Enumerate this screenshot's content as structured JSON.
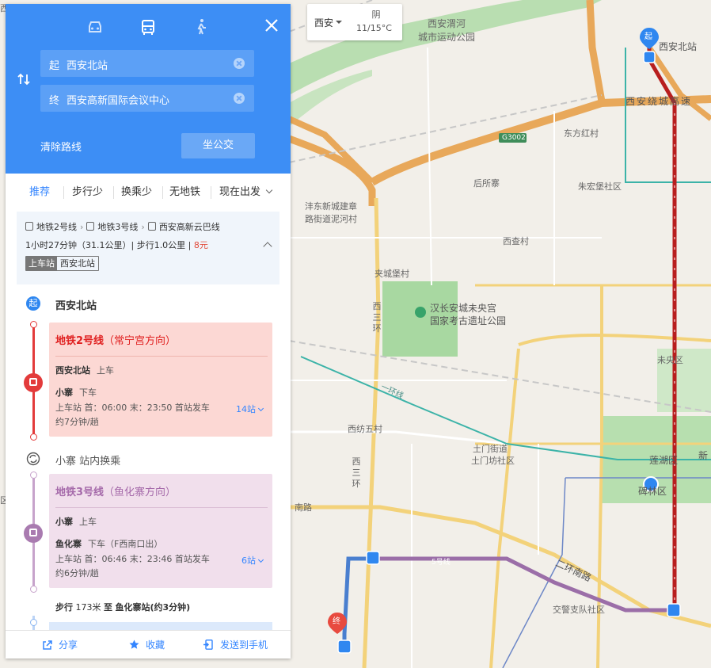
{
  "weather": {
    "city": "西安",
    "condition": "阴",
    "temp": "11/15°C"
  },
  "header": {
    "modes": [
      {
        "name": "drive",
        "icon": "car-icon"
      },
      {
        "name": "bus",
        "icon": "bus-icon",
        "active": true
      },
      {
        "name": "walk",
        "icon": "walk-icon"
      }
    ],
    "start_tag": "起",
    "start_value": "西安北站",
    "end_tag": "终",
    "end_value": "西安高新国际会议中心",
    "clear_label": "清除路线",
    "bus_button": "坐公交"
  },
  "prefs": {
    "items": [
      "推荐",
      "步行少",
      "换乘少",
      "无地铁"
    ],
    "depart_label": "现在出发"
  },
  "plan": {
    "lines": [
      "地铁2号线",
      "地铁3号线",
      "西安高新云巴线"
    ],
    "stats_prefix": "1小时27分钟（31.1公里）| 步行1.0公里 | ",
    "price": "8元",
    "board_key": "上车站",
    "board_value": "西安北站"
  },
  "route": {
    "start_circle": "起",
    "start_station": "西安北站",
    "segments": [
      {
        "line": "地铁2号线",
        "direction": "（常宁宫方向）",
        "board_station": "西安北站",
        "board_label": "上车",
        "alight_station": "小寨",
        "alight_label": "下车",
        "schedule": "上车站 首：06:00  末：23:50  首站发车",
        "interval": "约7分钟/趟",
        "stops": "14站"
      },
      {
        "line": "地铁3号线",
        "direction": "（鱼化寨方向）",
        "board_station": "小寨",
        "board_label": "上车",
        "alight_station": "鱼化寨",
        "alight_label": "下车（F西南口出）",
        "schedule": "上车站 首：06:46  末：23:46  首站发车",
        "interval": "约6分钟/趟",
        "stops": "6站"
      }
    ],
    "transfer_station": "小寨",
    "transfer_label": "站内换乘",
    "walk_prefix": "步行",
    "walk_distance": "173米",
    "walk_to": "至",
    "walk_target": "鱼化寨站(约3分钟)"
  },
  "bottom": {
    "share": "分享",
    "favorite": "收藏",
    "send": "发送到手机"
  },
  "map": {
    "labels": [
      "西安渭河",
      "城市运动公园",
      "西安北站",
      "西安绕城高速",
      "G3002",
      "东方红村",
      "后所寨",
      "朱宏堡社区",
      "沣东新城建章",
      "路街道泥河村",
      "西查村",
      "夹城堡村",
      "汉长安城未央宫",
      "国家考古遗址公园",
      "未央区",
      "一环线",
      "西纺五村",
      "土门街道",
      "土门坊社区",
      "莲湖区",
      "碑林区",
      "南路",
      "二环南路",
      "交警支队社区",
      "5号线",
      "新",
      "西三环",
      "西三环",
      "起",
      "终",
      "西",
      "区"
    ]
  },
  "colors": {
    "accent": "#3d8ef5",
    "line2": "#d62b2b",
    "line3": "#a56aaa",
    "link": "#3385ff",
    "price": "#e14b3b"
  }
}
